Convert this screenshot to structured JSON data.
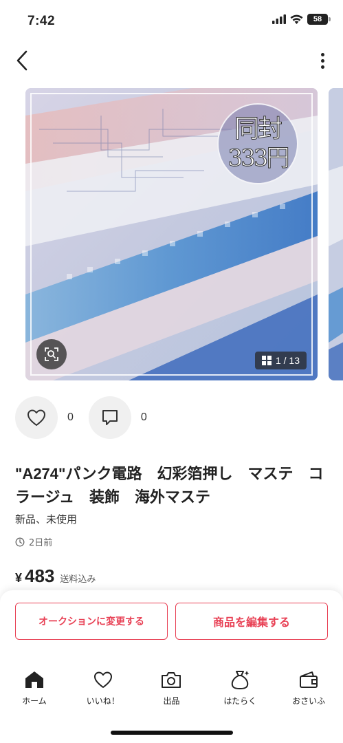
{
  "status_bar": {
    "time": "7:42",
    "battery": "58"
  },
  "carousel": {
    "counter": "1 / 13",
    "stamp_line1": "同封",
    "stamp_line2": "333円"
  },
  "actions": {
    "like_count": "0",
    "comment_count": "0"
  },
  "item": {
    "title": "\"A274\"パンク電路　幻彩箔押し　マステ　コラージュ　装飾　海外マステ",
    "condition": "新品、未使用",
    "posted": "2日前",
    "currency": "¥",
    "price": "483",
    "shipping": "送料込み"
  },
  "buttons": {
    "auction": "オークションに変更する",
    "edit": "商品を編集する"
  },
  "tabs": [
    {
      "label": "ホーム",
      "icon": "home-icon"
    },
    {
      "label": "いいね！",
      "icon": "heart-icon"
    },
    {
      "label": "出品",
      "icon": "camera-icon"
    },
    {
      "label": "はたらく",
      "icon": "money-bag-icon"
    },
    {
      "label": "おさいふ",
      "icon": "wallet-icon"
    }
  ],
  "colors": {
    "accent": "#e84155",
    "text": "#222222"
  }
}
